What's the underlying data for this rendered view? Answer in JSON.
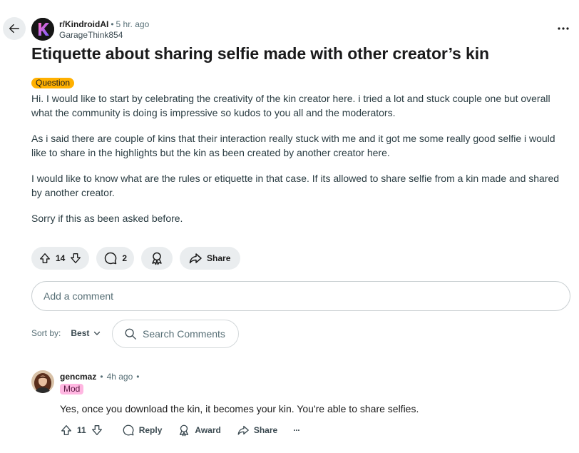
{
  "post": {
    "subreddit": "r/KindroidAI",
    "separator": "•",
    "time": "5 hr. ago",
    "author": "GarageThink854",
    "title": "Etiquette about sharing selfie made with other creator’s kin",
    "flair": "Question",
    "paragraphs": [
      "Hi. I would like to start by celebrating the creativity of the kin creator here. i tried a lot and stuck couple one but overall what the community is doing is impressive so kudos to you all and the moderators.",
      "As i said there are couple of kins that their interaction really stuck with me and it got me some really good selfie i would like to share in the highlights but the kin as been created by another creator here.",
      "I would like to know what are the rules or etiquette in that case. If its allowed to share selfie from a kin made and shared by another creator.",
      "Sorry if this as been asked before."
    ],
    "votes": "14",
    "comments_count": "2",
    "share_label": "Share"
  },
  "comment_input": {
    "placeholder": "Add a comment"
  },
  "sort": {
    "label": "Sort by:",
    "value": "Best"
  },
  "search": {
    "placeholder": "Search Comments"
  },
  "comments": [
    {
      "author": "gencmaz",
      "separator": "•",
      "time": "4h ago",
      "trailing_sep": "•",
      "tag": "Mod",
      "text": "Yes, once you download the kin, it becomes your kin. You're able to share selfies.",
      "votes": "11",
      "reply_label": "Reply",
      "award_label": "Award",
      "share_label": "Share",
      "more_label": "···"
    }
  ],
  "colors": {
    "flair": "#ffb000",
    "mod_tag": "#ffb6e1",
    "pill_bg": "#eaedef",
    "avatar_k_gradient": [
      "#ff6ec7",
      "#7b5cff"
    ]
  },
  "icons": {
    "back": "arrow-left-icon",
    "more": "more-horizontal-icon",
    "upvote": "arrow-up-icon",
    "downvote": "arrow-down-icon",
    "comment": "comment-bubble-icon",
    "award": "award-ribbon-icon",
    "share": "share-arrow-icon",
    "search": "search-icon",
    "chevron": "chevron-down-icon"
  }
}
